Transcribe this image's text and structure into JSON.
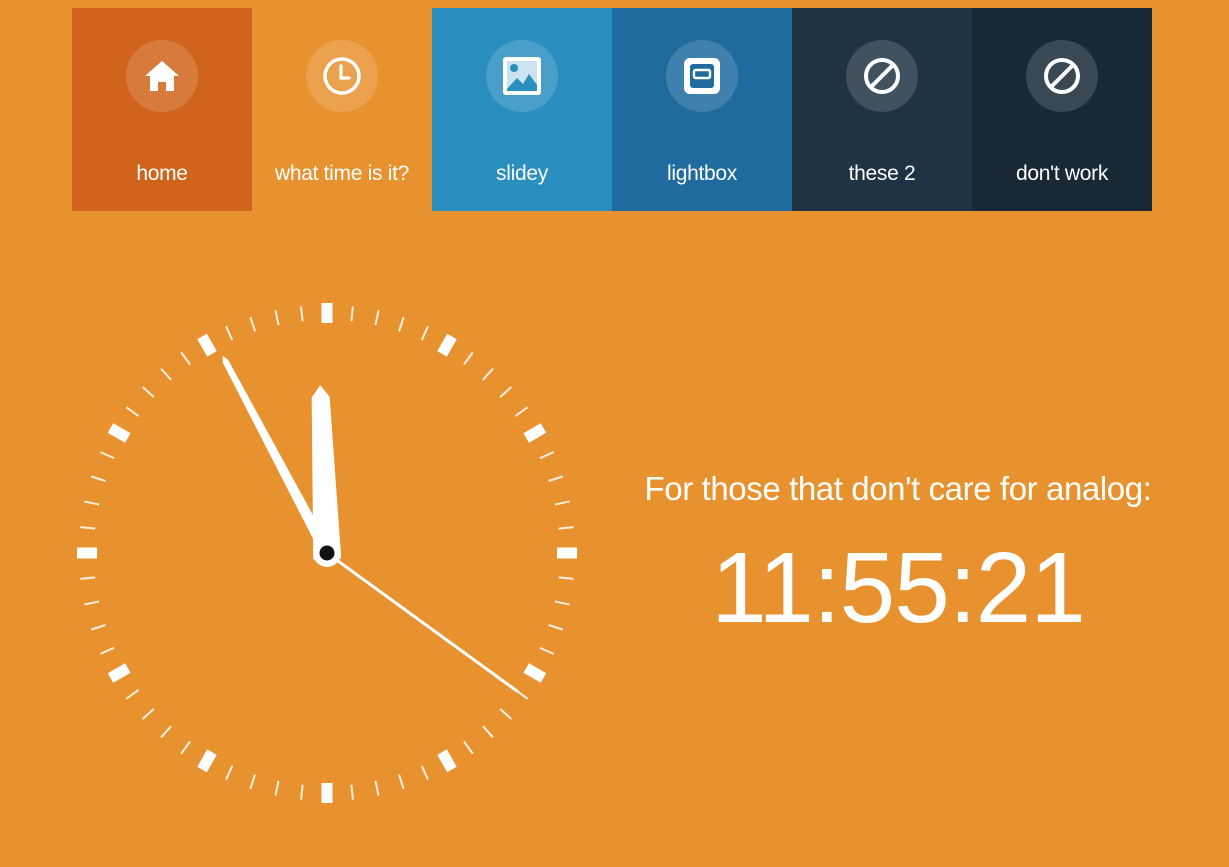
{
  "nav": {
    "items": [
      {
        "label": "home",
        "icon": "home-icon",
        "color": "#d0641c"
      },
      {
        "label": "what time is it?",
        "icon": "clock-icon",
        "color": "#e8922f"
      },
      {
        "label": "slidey",
        "icon": "image-icon",
        "color": "#2a8fbf"
      },
      {
        "label": "lightbox",
        "icon": "lightbox-icon",
        "color": "#1f6a9e"
      },
      {
        "label": "these 2",
        "icon": "ban-icon",
        "color": "#1f3344"
      },
      {
        "label": "don't work",
        "icon": "ban-icon",
        "color": "#182835"
      }
    ]
  },
  "clock": {
    "hours": 11,
    "minutes": 55,
    "seconds": 21,
    "hand_color": "#ffffff",
    "center_color": "#111111"
  },
  "caption": "For those that don't care for analog:",
  "digital_time": "11:55:21",
  "colors": {
    "background": "#e8922f",
    "text": "#ffffff"
  }
}
